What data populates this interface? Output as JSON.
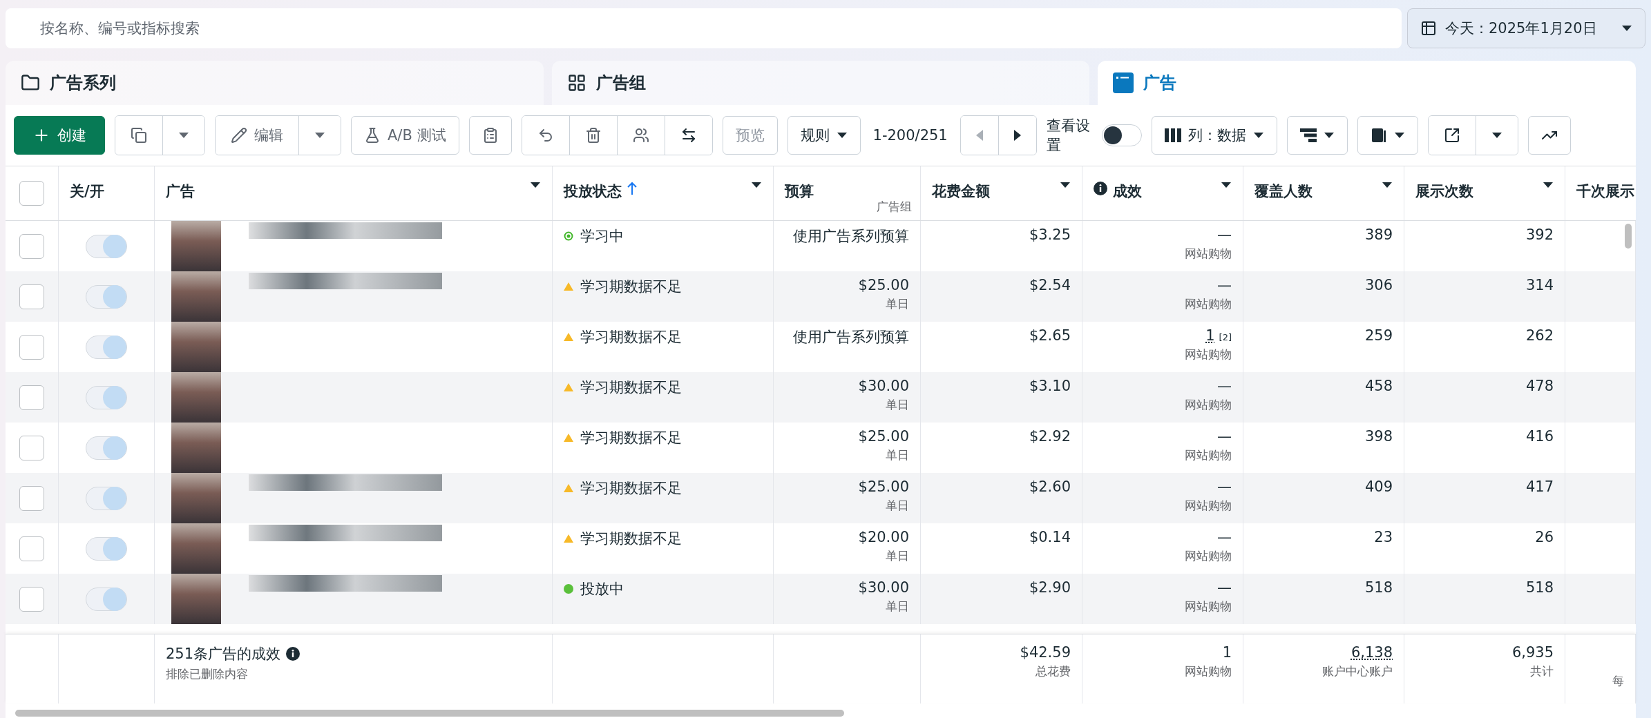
{
  "search": {
    "placeholder": "按名称、编号或指标搜索"
  },
  "date_picker": {
    "label": "今天：2025年1月20日"
  },
  "tabs": [
    {
      "label": "广告系列",
      "selected": false
    },
    {
      "label": "广告组",
      "selected": false
    },
    {
      "label": "广告",
      "selected": true
    }
  ],
  "toolbar": {
    "create": "创建",
    "edit": "编辑",
    "ab_test": "A/B 测试",
    "preview": {
      "label": "预览",
      "disabled": true
    },
    "rules": "规则",
    "pager": {
      "text": "1-200/251",
      "prev_disabled": true
    },
    "view_settings": {
      "label": "查看设置",
      "on": false
    },
    "columns": "列：数据"
  },
  "table": {
    "select_all": {
      "checked": false
    },
    "columns": [
      {
        "label": "关/开",
        "menu": false,
        "sorted": false
      },
      {
        "label": "广告",
        "menu": true,
        "sorted": false
      },
      {
        "label": "投放状态",
        "menu": true,
        "sorted": true
      },
      {
        "label": "预算",
        "sublabel": "广告组",
        "menu": false,
        "sorted": false
      },
      {
        "label": "花费金额",
        "menu": true,
        "sorted": false
      },
      {
        "label": "成效",
        "info": true,
        "menu": true,
        "sorted": false
      },
      {
        "label": "覆盖人数",
        "menu": true,
        "sorted": false
      },
      {
        "label": "展示次数",
        "menu": true,
        "sorted": false
      },
      {
        "label": "千次展示",
        "menu": false,
        "sorted": false
      }
    ],
    "rows": [
      {
        "checked": false,
        "on": true,
        "name_redacted": true,
        "status": {
          "kind": "learning",
          "label": "学习中"
        },
        "budget": {
          "value": "使用广告系列预算"
        },
        "spend": "$3.25",
        "results": {
          "value": "—",
          "note": "网站购物"
        },
        "reach": "389",
        "impressions": "392"
      },
      {
        "checked": false,
        "on": true,
        "name_redacted": true,
        "status": {
          "kind": "warning",
          "label": "学习期数据不足"
        },
        "budget": {
          "value": "$25.00",
          "note": "单日"
        },
        "spend": "$2.54",
        "results": {
          "value": "—",
          "note": "网站购物"
        },
        "reach": "306",
        "impressions": "314"
      },
      {
        "checked": false,
        "on": true,
        "name_redacted": false,
        "status": {
          "kind": "warning",
          "label": "学习期数据不足"
        },
        "budget": {
          "value": "使用广告系列预算"
        },
        "spend": "$2.65",
        "results": {
          "value": "1",
          "footnote": "[2]",
          "note": "网站购物"
        },
        "reach": "259",
        "impressions": "262"
      },
      {
        "checked": false,
        "on": true,
        "name_redacted": false,
        "status": {
          "kind": "warning",
          "label": "学习期数据不足"
        },
        "budget": {
          "value": "$30.00",
          "note": "单日"
        },
        "spend": "$3.10",
        "results": {
          "value": "—",
          "note": "网站购物"
        },
        "reach": "458",
        "impressions": "478"
      },
      {
        "checked": false,
        "on": true,
        "name_redacted": false,
        "status": {
          "kind": "warning",
          "label": "学习期数据不足"
        },
        "budget": {
          "value": "$25.00",
          "note": "单日"
        },
        "spend": "$2.92",
        "results": {
          "value": "—",
          "note": "网站购物"
        },
        "reach": "398",
        "impressions": "416"
      },
      {
        "checked": false,
        "on": true,
        "name_redacted": true,
        "status": {
          "kind": "warning",
          "label": "学习期数据不足"
        },
        "budget": {
          "value": "$25.00",
          "note": "单日"
        },
        "spend": "$2.60",
        "results": {
          "value": "—",
          "note": "网站购物"
        },
        "reach": "409",
        "impressions": "417"
      },
      {
        "checked": false,
        "on": true,
        "name_redacted": true,
        "status": {
          "kind": "warning",
          "label": "学习期数据不足"
        },
        "budget": {
          "value": "$20.00",
          "note": "单日"
        },
        "spend": "$0.14",
        "results": {
          "value": "—",
          "note": "网站购物"
        },
        "reach": "23",
        "impressions": "26"
      },
      {
        "checked": false,
        "on": true,
        "name_redacted": true,
        "status": {
          "kind": "active",
          "label": "投放中"
        },
        "budget": {
          "value": "$30.00",
          "note": "单日"
        },
        "spend": "$2.90",
        "results": {
          "value": "—",
          "note": "网站购物"
        },
        "reach": "518",
        "impressions": "518"
      }
    ],
    "footer": {
      "title": "251条广告的成效",
      "subtitle": "排除已删除内容",
      "spend": {
        "value": "$42.59",
        "note": "总花费"
      },
      "results": {
        "value": "1",
        "note": "网站购物"
      },
      "reach": {
        "value": "6,138",
        "note": "账户中心账户"
      },
      "impressions": {
        "value": "6,935",
        "note": "共计"
      },
      "cpm": {
        "note": "每"
      }
    }
  }
}
